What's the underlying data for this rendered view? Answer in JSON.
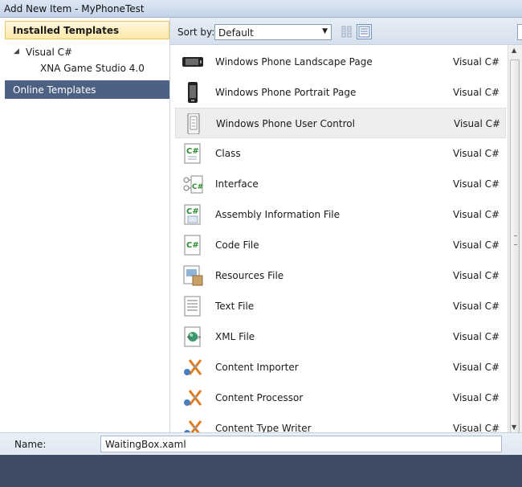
{
  "window": {
    "title": "Add New Item - MyPhoneTest"
  },
  "left": {
    "header": "Installed Templates",
    "tree": [
      {
        "label": "Visual C#",
        "expanded": true
      },
      {
        "label": "XNA Game Studio 4.0"
      }
    ],
    "online": "Online Templates"
  },
  "toolbar": {
    "sort_label": "Sort by:",
    "sort_value": "Default",
    "view_small_icon": "small-icons-view-icon",
    "view_medium_icon": "medium-icons-view-icon"
  },
  "items": [
    {
      "name": "Windows Phone Landscape Page",
      "lang": "Visual C#",
      "icon": "phone-landscape-icon"
    },
    {
      "name": "Windows Phone Portrait Page",
      "lang": "Visual C#",
      "icon": "phone-portrait-icon"
    },
    {
      "name": "Windows Phone User Control",
      "lang": "Visual C#",
      "icon": "user-control-icon",
      "selected": true
    },
    {
      "name": "Class",
      "lang": "Visual C#",
      "icon": "csharp-class-icon"
    },
    {
      "name": "Interface",
      "lang": "Visual C#",
      "icon": "csharp-interface-icon"
    },
    {
      "name": "Assembly Information File",
      "lang": "Visual C#",
      "icon": "assembly-info-icon"
    },
    {
      "name": "Code File",
      "lang": "Visual C#",
      "icon": "csharp-code-file-icon"
    },
    {
      "name": "Resources File",
      "lang": "Visual C#",
      "icon": "resources-file-icon"
    },
    {
      "name": "Text File",
      "lang": "Visual C#",
      "icon": "text-file-icon"
    },
    {
      "name": "XML File",
      "lang": "Visual C#",
      "icon": "xml-file-icon"
    },
    {
      "name": "Content Importer",
      "lang": "Visual C#",
      "icon": "content-importer-icon"
    },
    {
      "name": "Content Processor",
      "lang": "Visual C#",
      "icon": "content-processor-icon"
    },
    {
      "name": "Content Type Writer",
      "lang": "Visual C#",
      "icon": "content-type-writer-icon"
    }
  ],
  "name_field": {
    "label": "Name:",
    "value": "WaitingBox.xaml"
  },
  "colors": {
    "online_selected_bg": "#4d6185",
    "header_bg": "#ffe9a8",
    "footer_bg": "#3d4b63"
  }
}
